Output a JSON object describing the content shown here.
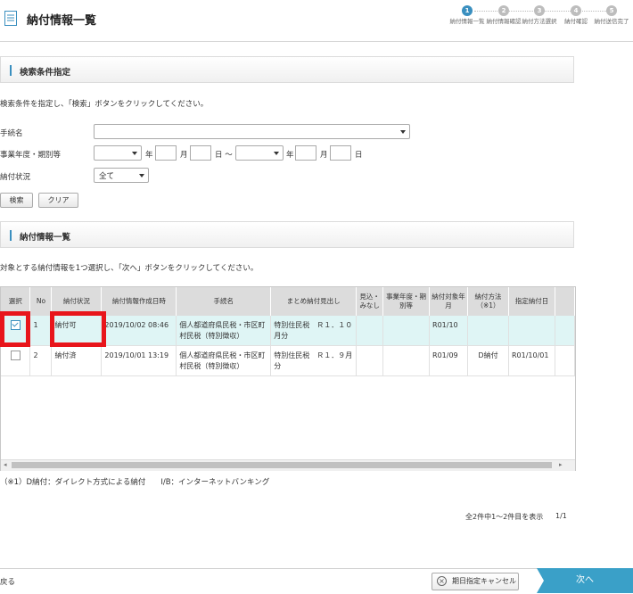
{
  "header": {
    "title": "納付情報一覧",
    "steps": [
      {
        "num": "1",
        "label": "納付情報一覧"
      },
      {
        "num": "2",
        "label": "納付情報確認"
      },
      {
        "num": "3",
        "label": "納付方法選択"
      },
      {
        "num": "4",
        "label": "納付確認"
      },
      {
        "num": "5",
        "label": "納付送信完了"
      }
    ]
  },
  "search": {
    "section_title": "検索条件指定",
    "instruction": "検索条件を指定し、「検索」ボタンをクリックしてください。",
    "procedure_label": "手続名",
    "procedure_value": "",
    "year_label": "事業年度・期別等",
    "year_unit": "年",
    "month_unit": "月",
    "day_unit": "日",
    "range_sep": "日 ～",
    "status_label": "納付状況",
    "status_value": "全て",
    "search_button": "検索",
    "clear_button": "クリア"
  },
  "list": {
    "section_title": "納付情報一覧",
    "instruction": "対象とする納付情報を1つ選択し、「次へ」ボタンをクリックしてください。",
    "columns": [
      "選択",
      "No",
      "納付状況",
      "納付情報作成日時",
      "手続名",
      "まとめ納付見出し",
      "見込・みなし",
      "事業年度・期別等",
      "納付対象年月",
      "納付方法（※1）",
      "指定納付日"
    ],
    "rows": [
      {
        "checked": true,
        "no": "1",
        "status": "納付可",
        "created": "2019/10/02 08:46",
        "procedure": "個人都道府県民税・市区町村民税（特別徴収）",
        "heading": "特別住民税　Ｒ１．１０月分",
        "estimate": "",
        "period": "",
        "target": "R01/10",
        "method": "",
        "date": ""
      },
      {
        "checked": false,
        "no": "2",
        "status": "納付済",
        "created": "2019/10/01 13:19",
        "procedure": "個人都道府県民税・市区町村民税（特別徴収）",
        "heading": "特別住民税　Ｒ１．９月分",
        "estimate": "",
        "period": "",
        "target": "R01/09",
        "method": "D納付",
        "date": "R01/10/01"
      }
    ],
    "note": "（※1）D納付：ダイレクト方式による納付　　I/B：インターネットバンキング",
    "count_text": "全2件中1～2件目を表示",
    "page_text": "1/1"
  },
  "footer": {
    "back_label": "戻る",
    "cancel_label": "期日指定キャンセル",
    "next_label": "次へ"
  },
  "colors": {
    "accent": "#3a8fbf",
    "highlight": "#e8151b",
    "selected_row": "#dff5f5"
  }
}
